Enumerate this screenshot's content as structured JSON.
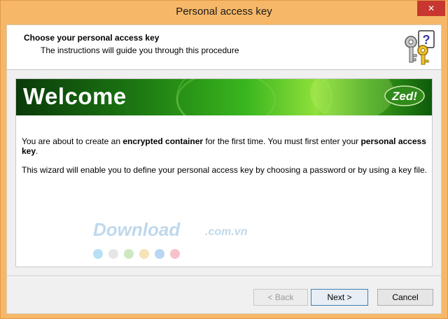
{
  "window": {
    "title": "Personal access key",
    "close_glyph": "✕"
  },
  "header": {
    "title": "Choose your personal access key",
    "subtitle": "The instructions will guide you through this procedure",
    "icon": "keys-question-icon"
  },
  "banner": {
    "title": "Welcome",
    "logo_text": "Zed!",
    "colors": {
      "dark": "#0a3a0a",
      "mid": "#39b51e",
      "light": "#8fe03a"
    }
  },
  "body": {
    "p1_a": "You are about to create an ",
    "p1_b": "encrypted container",
    "p1_c": " for the first time. You must first enter your ",
    "p1_d": "personal access key",
    "p1_e": ".",
    "p2": "This wizard will enable you to define your personal access key by choosing a password or by using a key file."
  },
  "watermark": {
    "text": "Download",
    "suffix": ".com.vn",
    "dot_colors": [
      "#b9dff5",
      "#e6e6e6",
      "#cde9c2",
      "#f8e2b8",
      "#b9d6f2",
      "#f5c2c8"
    ]
  },
  "buttons": {
    "back": "< Back",
    "next": "Next >",
    "cancel": "Cancel"
  }
}
